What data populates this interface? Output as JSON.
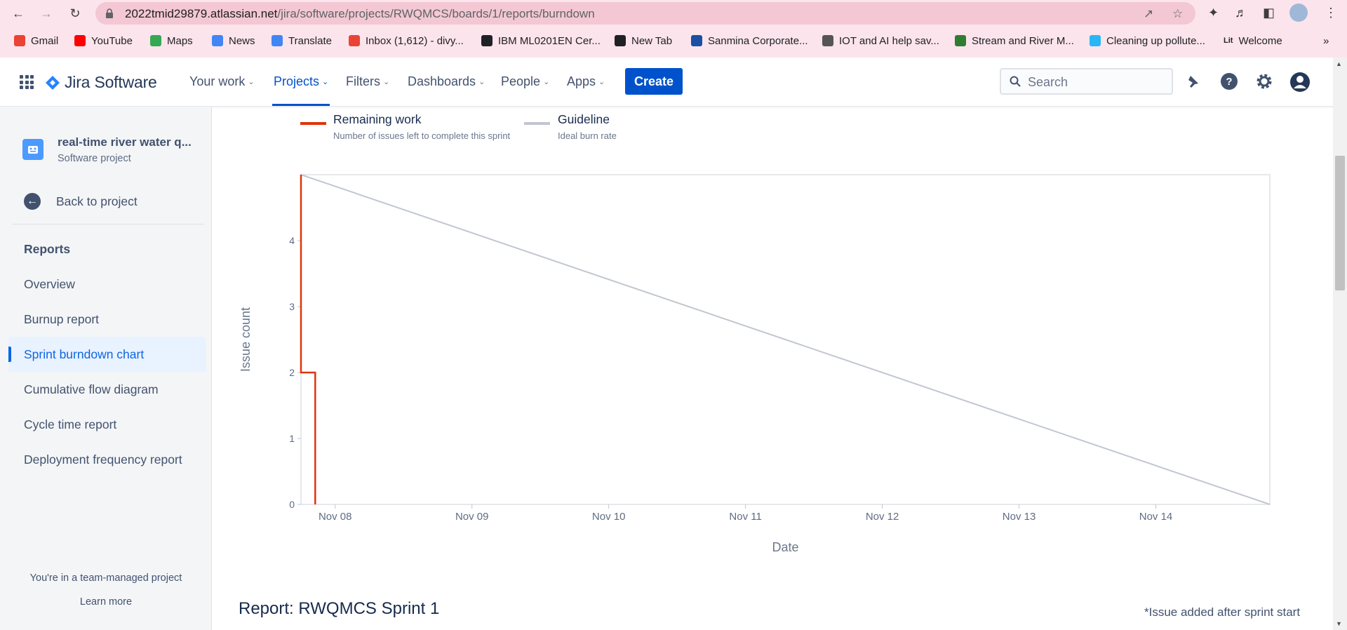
{
  "browser": {
    "url_host": "2022tmid29879.atlassian.net",
    "url_path": "/jira/software/projects/RWQMCS/boards/1/reports/burndown",
    "bookmarks": [
      {
        "label": "Gmail",
        "color": "#ea4335",
        "icon": "gmail-icon"
      },
      {
        "label": "YouTube",
        "color": "#ff0000",
        "icon": "youtube-icon"
      },
      {
        "label": "Maps",
        "color": "#34a853",
        "icon": "maps-icon"
      },
      {
        "label": "News",
        "color": "#4285f4",
        "icon": "news-icon"
      },
      {
        "label": "Translate",
        "color": "#4285f4",
        "icon": "translate-icon"
      },
      {
        "label": "Inbox (1,612) - divy...",
        "color": "#ea4335",
        "icon": "gmail-icon"
      },
      {
        "label": "IBM ML0201EN Cer...",
        "color": "#202124",
        "icon": "globe-icon"
      },
      {
        "label": "New Tab",
        "color": "#202124",
        "icon": "globe-icon"
      },
      {
        "label": "Sanmina Corporate...",
        "color": "#1a4fa3",
        "icon": "sanmina-icon"
      },
      {
        "label": "IOT and AI help sav...",
        "color": "#555555",
        "icon": "bike-icon"
      },
      {
        "label": "Stream and River M...",
        "color": "#2e7d32",
        "icon": "f-icon"
      },
      {
        "label": "Cleaning up pollute...",
        "color": "#29b6f6",
        "icon": "circle-icon"
      },
      {
        "label": "Welcome",
        "color": "#202124",
        "icon": "lit-icon"
      }
    ],
    "lit_text": "Lit"
  },
  "topnav": {
    "logo": "Jira Software",
    "menu": [
      "Your work",
      "Projects",
      "Filters",
      "Dashboards",
      "People",
      "Apps"
    ],
    "create": "Create",
    "search_placeholder": "Search"
  },
  "sidebar": {
    "project_name": "real-time river water q...",
    "project_type": "Software project",
    "back": "Back to project",
    "heading": "Reports",
    "items": [
      "Overview",
      "Burnup report",
      "Sprint burndown chart",
      "Cumulative flow diagram",
      "Cycle time report",
      "Deployment frequency report"
    ],
    "selected_index": 2,
    "footer": "You're in a team-managed project",
    "learn_more": "Learn more"
  },
  "legend": {
    "remaining_title": "Remaining work",
    "remaining_sub": "Number of issues left to complete this sprint",
    "guideline_title": "Guideline",
    "guideline_sub": "Ideal burn rate",
    "remaining_color": "#de350b",
    "guideline_color": "#c1c7d0"
  },
  "chart_data": {
    "type": "line",
    "xlabel": "Date",
    "ylabel": "Issue count",
    "x_ticks": [
      "Nov 08",
      "Nov 09",
      "Nov 10",
      "Nov 11",
      "Nov 12",
      "Nov 13",
      "Nov 14"
    ],
    "y_ticks": [
      0,
      1,
      2,
      3,
      4
    ],
    "ylim": [
      0,
      5
    ],
    "xlim": [
      "2022-11-07 18:00",
      "2022-11-14 20:00"
    ],
    "series": [
      {
        "name": "Remaining work",
        "color": "#de350b",
        "points": [
          {
            "x": "2022-11-07 18:00",
            "y": 5
          },
          {
            "x": "2022-11-07 18:00",
            "y": 2
          },
          {
            "x": "2022-11-07 20:30",
            "y": 2
          },
          {
            "x": "2022-11-07 20:30",
            "y": 0
          }
        ]
      },
      {
        "name": "Guideline",
        "color": "#c1c7d0",
        "points": [
          {
            "x": "2022-11-07 18:00",
            "y": 5
          },
          {
            "x": "2022-11-14 20:00",
            "y": 0
          }
        ]
      }
    ]
  },
  "report": {
    "title": "Report: RWQMCS Sprint 1",
    "note": "*Issue added after sprint start"
  }
}
